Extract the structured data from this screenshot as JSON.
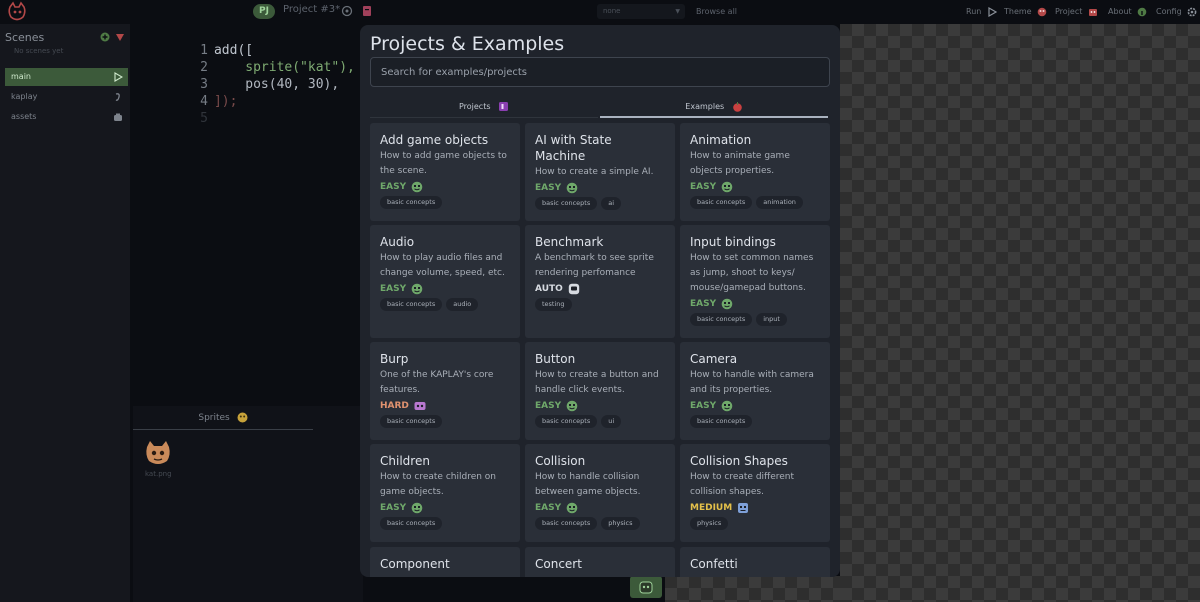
{
  "topbar": {
    "project_badge": "PJ",
    "project_name": "Project #3*",
    "scene_select": "none",
    "browse_all": "Browse all",
    "nav": {
      "run": "Run",
      "theme": "Theme",
      "project": "Project",
      "about": "About",
      "config": "Config"
    }
  },
  "scenes": {
    "title": "Scenes",
    "empty": "No scenes yet",
    "items": [
      {
        "label": "main"
      },
      {
        "label": "kaplay"
      },
      {
        "label": "assets"
      }
    ]
  },
  "editor": {
    "lines": [
      {
        "n": "1",
        "code": "add(["
      },
      {
        "n": "2",
        "code": "    sprite(\"kat\"),"
      },
      {
        "n": "3",
        "code": "    pos(40, 30),"
      },
      {
        "n": "4",
        "code": "]);"
      },
      {
        "n": "5",
        "code": ""
      }
    ]
  },
  "assets_panel": {
    "tab": "Sprites",
    "sprite": "kat.png"
  },
  "modal": {
    "title": "Projects & Examples",
    "search_placeholder": "Search for examples/projects",
    "tabs": {
      "projects": "Projects",
      "examples": "Examples"
    },
    "examples": [
      {
        "title": "Add game objects",
        "desc": "How to add game objects to the scene.",
        "difficulty": "EASY",
        "tags": [
          "basic concepts"
        ]
      },
      {
        "title": "AI with State Machine",
        "desc": "How to create a simple AI.",
        "difficulty": "EASY",
        "tags": [
          "basic concepts",
          "ai"
        ]
      },
      {
        "title": "Animation",
        "desc": "How to animate game objects properties.",
        "difficulty": "EASY",
        "tags": [
          "basic concepts",
          "animation"
        ]
      },
      {
        "title": "Audio",
        "desc": "How to play audio files and change volume, speed, etc.",
        "difficulty": "EASY",
        "tags": [
          "basic concepts",
          "audio"
        ]
      },
      {
        "title": "Benchmark",
        "desc": "A benchmark to see sprite rendering perfomance",
        "difficulty": "AUTO",
        "tags": [
          "testing"
        ]
      },
      {
        "title": "Input bindings",
        "desc": "How to set common names as jump, shoot to keys/ mouse/gamepad buttons.",
        "difficulty": "EASY",
        "tags": [
          "basic concepts",
          "input"
        ]
      },
      {
        "title": "Burp",
        "desc": "One of the KAPLAY's core features.",
        "difficulty": "HARD",
        "tags": [
          "basic concepts"
        ]
      },
      {
        "title": "Button",
        "desc": "How to create a button and handle click events.",
        "difficulty": "EASY",
        "tags": [
          "basic concepts",
          "ui"
        ]
      },
      {
        "title": "Camera",
        "desc": "How to handle with camera and its properties.",
        "difficulty": "EASY",
        "tags": [
          "basic concepts"
        ]
      },
      {
        "title": "Children",
        "desc": "How to create children on game objects.",
        "difficulty": "EASY",
        "tags": [
          "basic concepts"
        ]
      },
      {
        "title": "Collision",
        "desc": "How to handle collision between game objects.",
        "difficulty": "EASY",
        "tags": [
          "basic concepts",
          "physics"
        ]
      },
      {
        "title": "Collision Shapes",
        "desc": "How to create different collision shapes.",
        "difficulty": "MEDIUM",
        "tags": [
          "physics"
        ]
      },
      {
        "title": "Component",
        "desc": "",
        "difficulty": "",
        "tags": []
      },
      {
        "title": "Concert",
        "desc": "",
        "difficulty": "",
        "tags": []
      },
      {
        "title": "Confetti",
        "desc": "",
        "difficulty": "",
        "tags": []
      }
    ]
  },
  "colors": {
    "easy": "#6fa86a",
    "auto": "#d6dae0",
    "hard": "#e0926f",
    "medium": "#e4c04a",
    "active_green": "#3c5a3a"
  }
}
